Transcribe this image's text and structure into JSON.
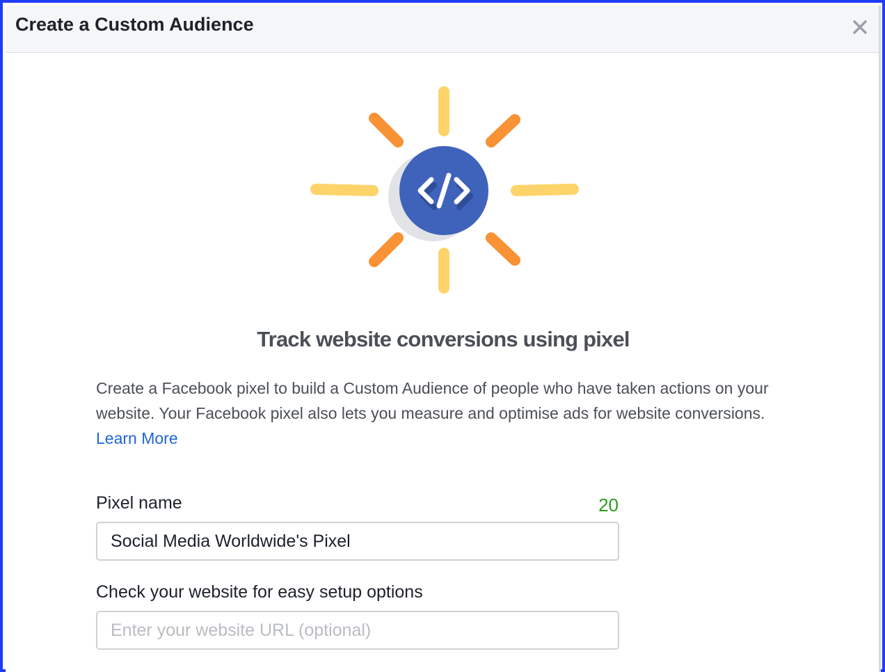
{
  "dialog": {
    "title": "Create a Custom Audience",
    "close_icon": "close-icon"
  },
  "illustration": {
    "icon": "code-icon",
    "colors": {
      "circle": "#3f62bb",
      "shadow": "#e2e3e6",
      "ray_yellow": "#fdd46a",
      "ray_orange": "#f99135"
    }
  },
  "content": {
    "headline": "Track website conversions using pixel",
    "description": "Create a Facebook pixel to build a Custom Audience of people who have taken actions on your website. Your Facebook pixel also lets you measure and optimise ads for website conversions.",
    "learn_more_label": "Learn More"
  },
  "form": {
    "pixel_name": {
      "label": "Pixel name",
      "remaining_chars": "20",
      "value": "Social Media Worldwide's Pixel"
    },
    "website": {
      "label": "Check your website for easy setup options",
      "value": "",
      "placeholder": "Enter your website URL (optional)"
    }
  },
  "colors": {
    "frame_border": "#1f3cf5",
    "link": "#1d66d6",
    "counter": "#2c9c1c"
  }
}
